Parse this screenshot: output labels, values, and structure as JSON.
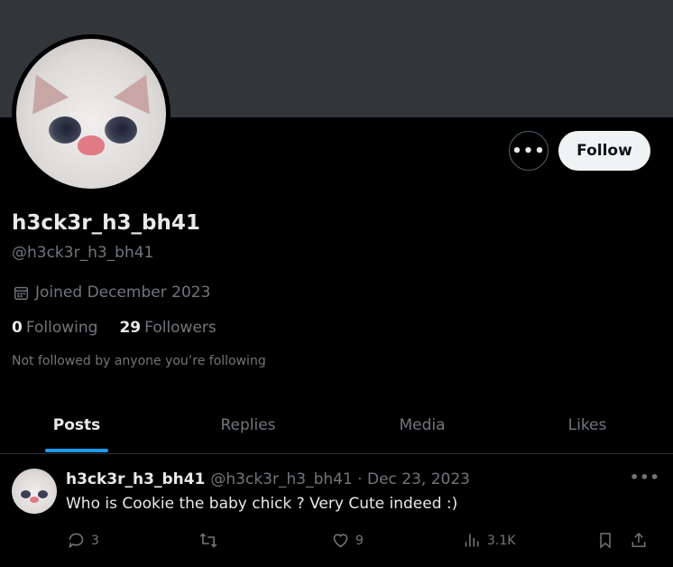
{
  "profile": {
    "display_name": "h3ck3r_h3_bh41",
    "handle": "@h3ck3r_h3_bh41",
    "joined": "Joined December 2023",
    "following_count": "0",
    "following_label": "Following",
    "followers_count": "29",
    "followers_label": "Followers",
    "not_followed_text": "Not followed by anyone you’re following",
    "follow_label": "Follow",
    "more_label": "•••"
  },
  "tabs": [
    {
      "label": "Posts",
      "active": true
    },
    {
      "label": "Replies",
      "active": false
    },
    {
      "label": "Media",
      "active": false
    },
    {
      "label": "Likes",
      "active": false
    }
  ],
  "post": {
    "author_name": "h3ck3r_h3_bh41",
    "meta": "@h3ck3r_h3_bh41 · Dec 23, 2023",
    "text": "Who is Cookie the baby chick ? Very Cute indeed :)",
    "more_label": "•••",
    "replies": "3",
    "likes": "9",
    "views": "3.1K"
  },
  "colors": {
    "accent": "#1d9bf0",
    "muted_text": "#71767b",
    "primary_text": "#e7e9ea",
    "banner": "#333639"
  },
  "icons": [
    "calendar-icon",
    "more-icon",
    "reply-icon",
    "repost-icon",
    "like-icon",
    "views-icon",
    "bookmark-icon",
    "share-icon"
  ]
}
